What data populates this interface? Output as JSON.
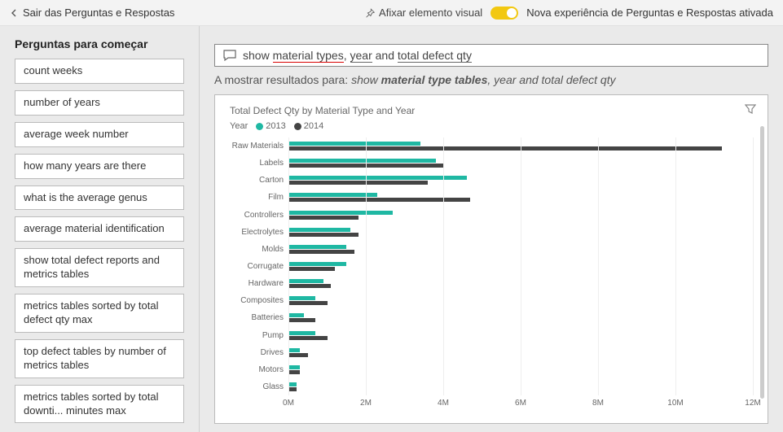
{
  "topbar": {
    "back_label": "Sair das Perguntas e Respostas",
    "pin_label": "Afixar elemento visual",
    "toggle_label": "Nova experiência de Perguntas e Respostas ativada"
  },
  "left": {
    "heading": "Perguntas para começar",
    "suggestions": [
      "count weeks",
      "number of years",
      "average week number",
      "how many years are there",
      "what is the average genus",
      "average material identification",
      "show total defect reports and metrics tables",
      "metrics tables sorted by total defect qty max",
      "top defect tables by number of metrics tables",
      "metrics tables sorted by total downti... minutes max"
    ]
  },
  "query": {
    "pre": "show ",
    "seg1": "material types",
    "mid1": ", ",
    "seg2": "year",
    "mid2": " and ",
    "seg3": "total defect qty"
  },
  "result": {
    "prefix": "A mostrar resultados para: ",
    "show": "show ",
    "bold": "material type tables",
    "rest": ", year and total defect qty"
  },
  "chart_data": {
    "type": "bar",
    "orientation": "horizontal",
    "title": "Total Defect Qty by Material Type and Year",
    "legend_label": "Year",
    "xlabel": "",
    "ylabel": "",
    "xlim": [
      0,
      12000000
    ],
    "xticks": [
      "0M",
      "2M",
      "4M",
      "6M",
      "8M",
      "10M",
      "12M"
    ],
    "categories": [
      "Raw Materials",
      "Labels",
      "Carton",
      "Film",
      "Controllers",
      "Electrolytes",
      "Molds",
      "Corrugate",
      "Hardware",
      "Composites",
      "Batteries",
      "Pump",
      "Drives",
      "Motors",
      "Glass"
    ],
    "series": [
      {
        "name": "2013",
        "color": "#1fb8a3",
        "values": [
          3400000,
          3800000,
          4600000,
          2300000,
          2700000,
          1600000,
          1500000,
          1500000,
          900000,
          700000,
          400000,
          700000,
          300000,
          300000,
          200000
        ]
      },
      {
        "name": "2014",
        "color": "#444444",
        "values": [
          11200000,
          4000000,
          3600000,
          4700000,
          1800000,
          1800000,
          1700000,
          1200000,
          1100000,
          1000000,
          700000,
          1000000,
          500000,
          300000,
          200000
        ]
      }
    ]
  }
}
